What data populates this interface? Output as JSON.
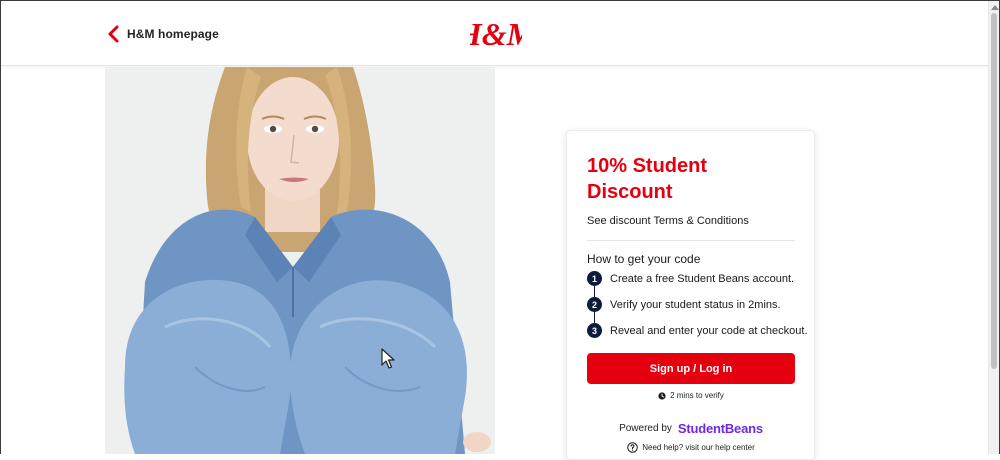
{
  "header": {
    "back_label": "H&M homepage",
    "logo_text": "H&M",
    "brand_color": "#e50010"
  },
  "offer": {
    "title": "10% Student Discount",
    "terms_link": "See discount Terms & Conditions",
    "howto_heading": "How to get your code",
    "steps": [
      {
        "num": "1",
        "text": "Create a free Student Beans account."
      },
      {
        "num": "2",
        "text": "Verify your student status in 2mins."
      },
      {
        "num": "3",
        "text": "Reveal and enter your code at checkout."
      }
    ],
    "cta_label": "Sign up / Log in",
    "verify_note": "2 mins to verify",
    "powered_by": "Powered by",
    "partner_name": "StudentBeans",
    "partner_color": "#6e2ae0",
    "help_text": "Need help? visit our help center"
  },
  "icons": {
    "back": "chevron-left-icon",
    "clock": "clock-icon",
    "help": "question-circle-icon"
  }
}
